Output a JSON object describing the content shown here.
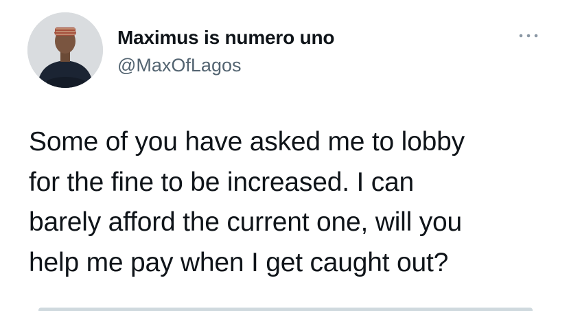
{
  "tweet": {
    "author": {
      "display_name": "Maximus is numero uno",
      "handle": "@MaxOfLagos",
      "avatar_icon": "profile-photo"
    },
    "more_icon": "more-horizontal-icon",
    "text_lines": [
      "Some of you have asked me to lobby",
      "for the fine to be increased. I can",
      "barely afford the current one, will you",
      "help me pay when I get caught out?"
    ]
  },
  "colors": {
    "text_primary": "#0f1419",
    "text_secondary": "#536471",
    "border": "#cfd9de"
  }
}
